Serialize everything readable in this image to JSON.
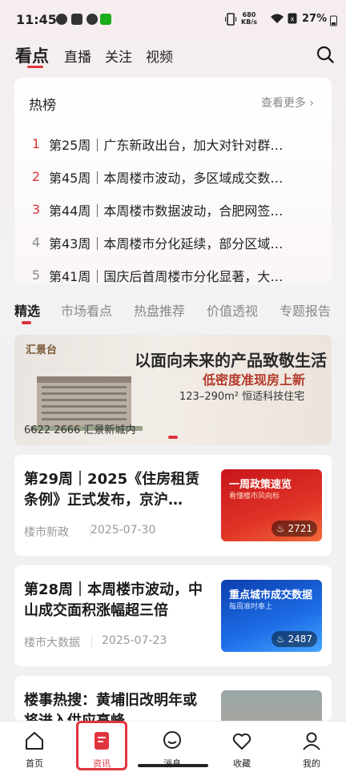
{
  "status_bar": {
    "time": "11:45",
    "net_speed": "680",
    "net_unit": "KB/s",
    "battery": "27%"
  },
  "nav": {
    "tabs": [
      "看点",
      "直播",
      "关注",
      "视频"
    ]
  },
  "hot": {
    "title": "热榜",
    "more": "查看更多",
    "items": [
      {
        "rank": "1",
        "text": "第25周｜广东新政出台，加大对针对群…"
      },
      {
        "rank": "2",
        "text": "第45周｜本周楼市波动，多区域成交数…"
      },
      {
        "rank": "3",
        "text": "第44周｜本周楼市数据波动，合肥网签…"
      },
      {
        "rank": "4",
        "text": "第43周｜本周楼市分化延续，部分区域…"
      },
      {
        "rank": "5",
        "text": "第41周｜国庆后首周楼市分化显著，大…"
      }
    ]
  },
  "category_tabs": [
    "精选",
    "市场看点",
    "热盘推荐",
    "价值透视",
    "专题报告"
  ],
  "banner": {
    "logo": "汇景台",
    "headline": "以面向未来的产品致敬生活",
    "sub": "低密度准现房上新",
    "detail": "123–290m² 恒适科技住宅",
    "phone": "6622 2666 汇景新城内"
  },
  "articles": [
    {
      "title": "第29周｜2025《住房租赁条例》正式发布，京沪…",
      "source": "楼市新政",
      "date": "2025-07-30",
      "thumb_title": "一周政策速览",
      "thumb_sub": "看懂楼市风向标",
      "views": "2721"
    },
    {
      "title": "第28周｜本周楼市波动，中山成交面积涨幅超三倍",
      "source": "楼市大数据",
      "date": "2025-07-23",
      "thumb_title": "重点城市成交数据",
      "thumb_sub": "每周准时奉上",
      "views": "2487"
    },
    {
      "title": "楼事热搜：黄埔旧改明年或将进入供应高峰"
    }
  ],
  "tabbar": {
    "items": [
      "首页",
      "资讯",
      "消息",
      "收藏",
      "我的"
    ]
  }
}
